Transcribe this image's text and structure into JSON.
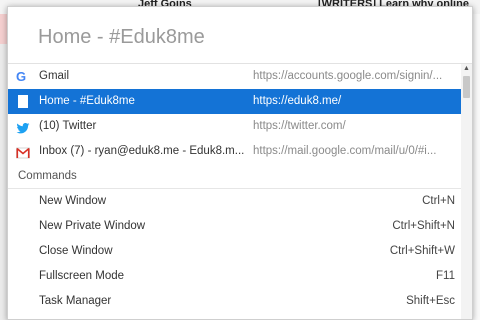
{
  "background": {
    "top_text_1": "Jeff Goins",
    "top_text_2": "[WRITERS] Learn why online"
  },
  "search": {
    "value": "Home - #Eduk8me"
  },
  "results": [
    {
      "icon": "google-icon",
      "title": "Gmail",
      "url": "https://accounts.google.com/signin/..."
    },
    {
      "icon": "document-icon",
      "title": "Home - #Eduk8me",
      "url": "https://eduk8.me/",
      "selected": true
    },
    {
      "icon": "twitter-icon",
      "title": "(10) Twitter",
      "url": "https://twitter.com/"
    },
    {
      "icon": "gmail-icon",
      "title": "Inbox (7) - ryan@eduk8.me - Eduk8.m...",
      "url": "https://mail.google.com/mail/u/0/#i..."
    }
  ],
  "commands_header": "Commands",
  "commands": [
    {
      "label": "New Window",
      "shortcut": "Ctrl+N"
    },
    {
      "label": "New Private Window",
      "shortcut": "Ctrl+Shift+N"
    },
    {
      "label": "Close Window",
      "shortcut": "Ctrl+Shift+W"
    },
    {
      "label": "Fullscreen Mode",
      "shortcut": "F11"
    },
    {
      "label": "Task Manager",
      "shortcut": "Shift+Esc"
    }
  ],
  "colors": {
    "selection": "#1473d6",
    "twitter": "#1da1f2",
    "gmail": "#d93025"
  }
}
